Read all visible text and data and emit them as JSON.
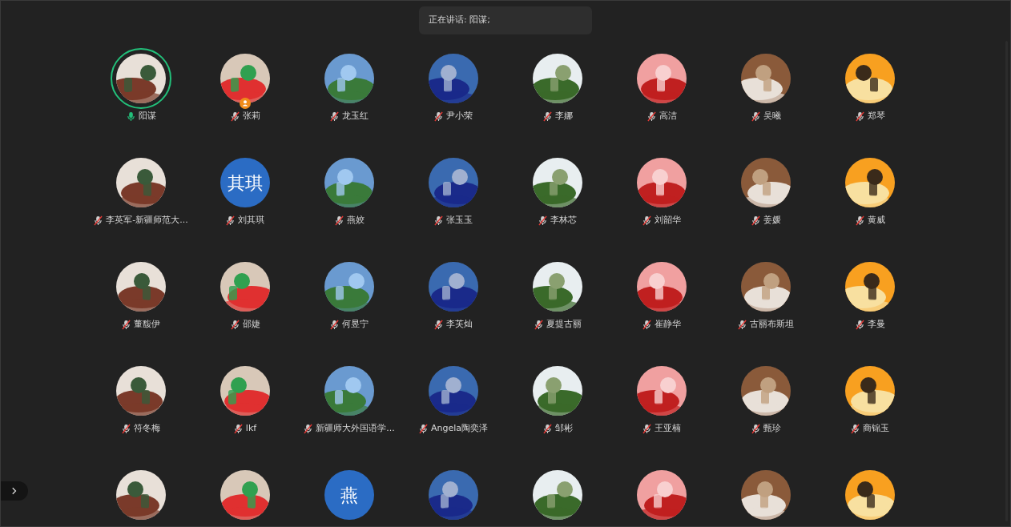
{
  "speaking_banner": {
    "label": "正在讲话: 阳谋;"
  },
  "participants": [
    {
      "name": "阳谋",
      "kind": "picture",
      "muted": false,
      "speaking": true,
      "host": false
    },
    {
      "name": "张莉",
      "kind": "picture",
      "muted": true,
      "speaking": false,
      "host": true
    },
    {
      "name": "龙玉红",
      "kind": "picture",
      "muted": true,
      "speaking": false,
      "host": false
    },
    {
      "name": "尹小荣",
      "kind": "picture",
      "muted": true,
      "speaking": false,
      "host": false
    },
    {
      "name": "李娜",
      "kind": "picture",
      "muted": true,
      "speaking": false,
      "host": false
    },
    {
      "name": "高洁",
      "kind": "picture",
      "muted": true,
      "speaking": false,
      "host": false
    },
    {
      "name": "吴曦",
      "kind": "picture",
      "muted": true,
      "speaking": false,
      "host": false
    },
    {
      "name": "郑琴",
      "kind": "picture",
      "muted": true,
      "speaking": false,
      "host": false
    },
    {
      "name": "李英军-新疆师范大...",
      "kind": "picture",
      "muted": true,
      "speaking": false,
      "host": false
    },
    {
      "name": "刘其琪",
      "kind": "initials",
      "initials": "其琪",
      "muted": true,
      "speaking": false,
      "host": false
    },
    {
      "name": "燕姣",
      "kind": "picture",
      "muted": true,
      "speaking": false,
      "host": false
    },
    {
      "name": "张玉玉",
      "kind": "picture",
      "muted": true,
      "speaking": false,
      "host": false
    },
    {
      "name": "李林芯",
      "kind": "picture",
      "muted": true,
      "speaking": false,
      "host": false
    },
    {
      "name": "刘韶华",
      "kind": "picture",
      "muted": true,
      "speaking": false,
      "host": false
    },
    {
      "name": "姜媛",
      "kind": "picture",
      "muted": true,
      "speaking": false,
      "host": false
    },
    {
      "name": "黄威",
      "kind": "picture",
      "muted": true,
      "speaking": false,
      "host": false
    },
    {
      "name": "董馥伊",
      "kind": "picture",
      "muted": true,
      "speaking": false,
      "host": false
    },
    {
      "name": "邵婕",
      "kind": "picture",
      "muted": true,
      "speaking": false,
      "host": false
    },
    {
      "name": "何昱宁",
      "kind": "picture",
      "muted": true,
      "speaking": false,
      "host": false
    },
    {
      "name": "李芙灿",
      "kind": "picture",
      "muted": true,
      "speaking": false,
      "host": false
    },
    {
      "name": "夏提古丽",
      "kind": "picture",
      "muted": true,
      "speaking": false,
      "host": false
    },
    {
      "name": "崔静华",
      "kind": "picture",
      "muted": true,
      "speaking": false,
      "host": false
    },
    {
      "name": "古丽布斯坦",
      "kind": "picture",
      "muted": true,
      "speaking": false,
      "host": false
    },
    {
      "name": "李曼",
      "kind": "picture",
      "muted": true,
      "speaking": false,
      "host": false
    },
    {
      "name": "符冬梅",
      "kind": "picture",
      "muted": true,
      "speaking": false,
      "host": false
    },
    {
      "name": "lkf",
      "kind": "picture",
      "muted": true,
      "speaking": false,
      "host": false
    },
    {
      "name": "新疆师大外国语学...",
      "kind": "picture",
      "muted": true,
      "speaking": false,
      "host": false
    },
    {
      "name": "Angela陶奕泽",
      "kind": "picture",
      "muted": true,
      "speaking": false,
      "host": false
    },
    {
      "name": "邹彬",
      "kind": "picture",
      "muted": true,
      "speaking": false,
      "host": false
    },
    {
      "name": "王亚楠",
      "kind": "picture",
      "muted": true,
      "speaking": false,
      "host": false
    },
    {
      "name": "甄珍",
      "kind": "picture",
      "muted": true,
      "speaking": false,
      "host": false
    },
    {
      "name": "商锦玉",
      "kind": "picture",
      "muted": true,
      "speaking": false,
      "host": false
    },
    {
      "kind": "picture",
      "speaking": false,
      "host": false
    },
    {
      "kind": "picture",
      "speaking": false,
      "host": false
    },
    {
      "kind": "initials",
      "initials": "燕",
      "speaking": false,
      "host": false
    },
    {
      "kind": "picture",
      "speaking": false,
      "host": false
    },
    {
      "kind": "picture",
      "speaking": false,
      "host": false
    },
    {
      "kind": "picture",
      "speaking": false,
      "host": false
    },
    {
      "kind": "picture",
      "speaking": false,
      "host": false
    },
    {
      "kind": "picture",
      "speaking": false,
      "host": false
    }
  ]
}
